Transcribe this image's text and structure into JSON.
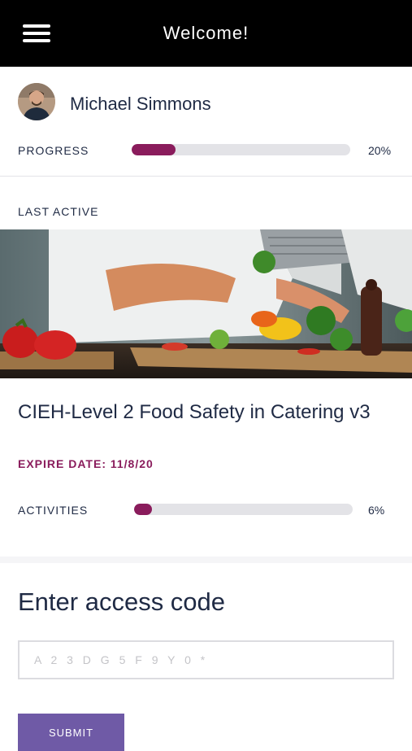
{
  "header": {
    "title": "Welcome!",
    "menu_icon": "hamburger-menu-icon"
  },
  "profile": {
    "name": "Michael Simmons",
    "avatar_icon": "user-avatar",
    "progress_label": "PROGRESS",
    "progress_value": 0.2,
    "progress_text": "20%"
  },
  "last_active": {
    "label": "LAST ACTIVE",
    "course": {
      "title": "CIEH-Level 2 Food Safety in Catering v3",
      "expire": "EXPIRE DATE: 11/8/20",
      "activities_label": "ACTIVITIES",
      "activities_value": 0.06,
      "activities_text": "6%"
    }
  },
  "access": {
    "heading": "Enter access code",
    "placeholder": "A 2 3 D G 5 F 9 Y 0 *",
    "value": "",
    "submit_label": "SUBMIT"
  },
  "colors": {
    "header_bg": "#000000",
    "accent": "#8a1c5c",
    "button": "#6f5aa6"
  }
}
